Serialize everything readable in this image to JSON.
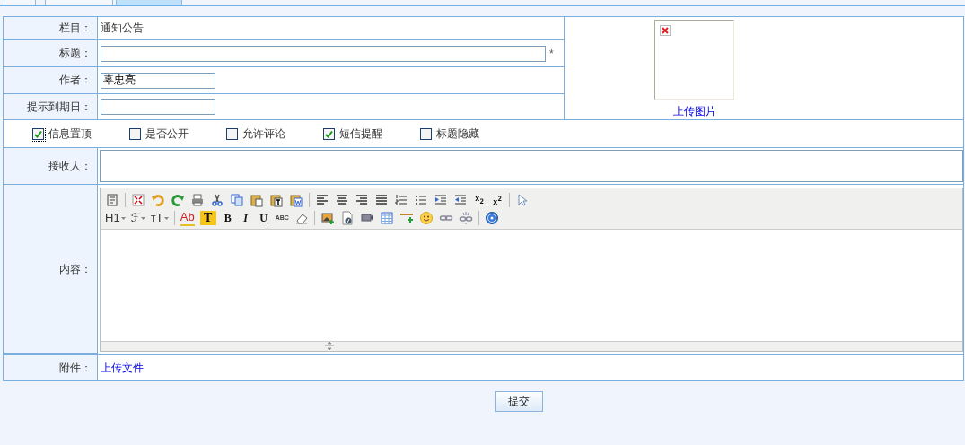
{
  "tabs": [
    {
      "selected": false
    },
    {
      "selected": false
    },
    {
      "selected": true
    }
  ],
  "rows": [
    {
      "kind": "static",
      "label": "栏目：",
      "value": "通知公告"
    },
    {
      "kind": "input",
      "label": "标题：",
      "wide": true,
      "required_mark": "*"
    },
    {
      "kind": "input",
      "label": "作者：",
      "wide": false,
      "value": "辜忠亮"
    },
    {
      "kind": "input",
      "label": "提示到期日：",
      "wide": false
    }
  ],
  "image": {
    "link": "上传图片"
  },
  "checkboxes": [
    {
      "label": "信息置顶",
      "checked": true,
      "focused": true
    },
    {
      "label": "是否公开",
      "checked": false,
      "focused": false
    },
    {
      "label": "允许评论",
      "checked": false,
      "focused": false
    },
    {
      "label": "短信提醒",
      "checked": true,
      "focused": false
    },
    {
      "label": "标题隐藏",
      "checked": false,
      "focused": false
    }
  ],
  "recipient": {
    "label": "接收人："
  },
  "content": {
    "label": "内容：",
    "toolbar": [
      [
        {
          "kind": "icon"
        },
        {
          "kind": "sep"
        },
        {
          "kind": "icon"
        },
        {
          "kind": "icon"
        },
        {
          "kind": "icon"
        },
        {
          "kind": "icon"
        },
        {
          "kind": "icon"
        },
        {
          "kind": "icon"
        },
        {
          "kind": "icon"
        },
        {
          "kind": "icon"
        },
        {
          "kind": "icon"
        },
        {
          "kind": "sep"
        },
        {
          "kind": "icon"
        },
        {
          "kind": "icon"
        },
        {
          "kind": "icon"
        },
        {
          "kind": "icon"
        },
        {
          "kind": "icon"
        },
        {
          "kind": "icon"
        },
        {
          "kind": "icon"
        },
        {
          "kind": "icon"
        },
        {
          "kind": "glyph",
          "text": "x$_{2}$"
        },
        {
          "kind": "glyph",
          "text": "x$^{2}$"
        },
        {
          "kind": "sep"
        },
        {
          "kind": "icon"
        }
      ],
      [
        {
          "kind": "dropdown",
          "text": "H1"
        },
        {
          "kind": "dropdown",
          "text": "ℱ"
        },
        {
          "kind": "dropdown",
          "text": "ᴛT"
        },
        {
          "kind": "sep"
        },
        {
          "kind": "glyph",
          "text": "Ab"
        },
        {
          "kind": "glyph",
          "text": "T"
        },
        {
          "kind": "glyph",
          "text": "B"
        },
        {
          "kind": "glyph",
          "text": "I"
        },
        {
          "kind": "glyph",
          "text": "U"
        },
        {
          "kind": "glyph",
          "text": "ABC"
        },
        {
          "kind": "icon"
        },
        {
          "kind": "sep"
        },
        {
          "kind": "icon"
        },
        {
          "kind": "icon"
        },
        {
          "kind": "icon"
        },
        {
          "kind": "icon"
        },
        {
          "kind": "icon"
        },
        {
          "kind": "icon"
        },
        {
          "kind": "icon"
        },
        {
          "kind": "icon"
        },
        {
          "kind": "sep"
        },
        {
          "kind": "icon"
        }
      ]
    ]
  },
  "attachment": {
    "label": "附件：",
    "link": "上传文件"
  },
  "submit": "提交"
}
